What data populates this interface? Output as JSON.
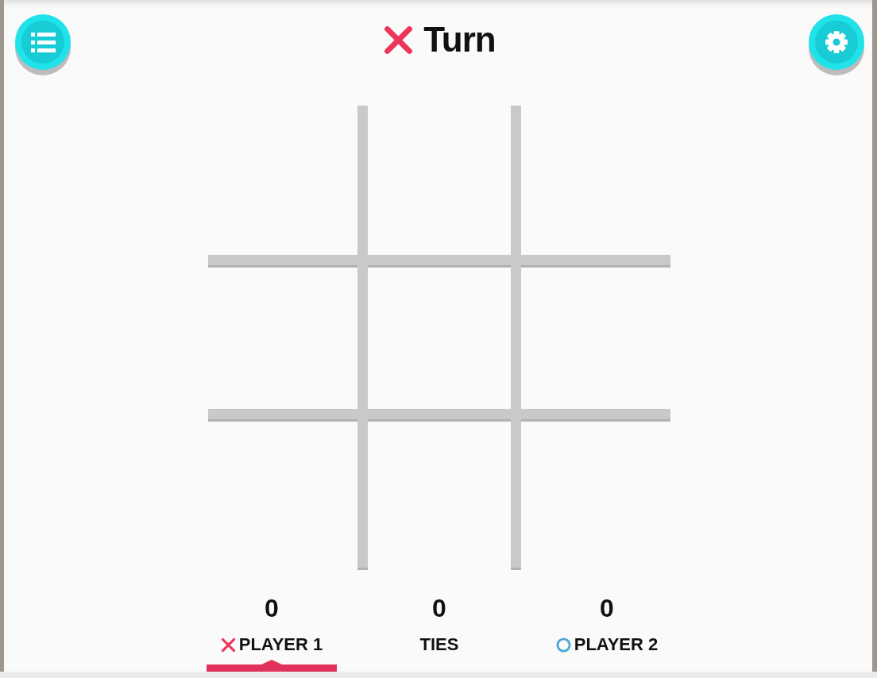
{
  "header": {
    "buttons": [
      {
        "kind": "menu"
      },
      {
        "kind": "settings"
      }
    ],
    "turn": {
      "kind": "x",
      "label": "Turn"
    }
  },
  "scores": [
    {
      "value": "0",
      "label": "PLAYER 1",
      "kind": "x",
      "selected": true
    },
    {
      "value": "0",
      "label": "TIES",
      "kind": "none",
      "selected": false
    },
    {
      "value": "0",
      "label": "PLAYER 2",
      "kind": "o",
      "selected": false
    }
  ]
}
